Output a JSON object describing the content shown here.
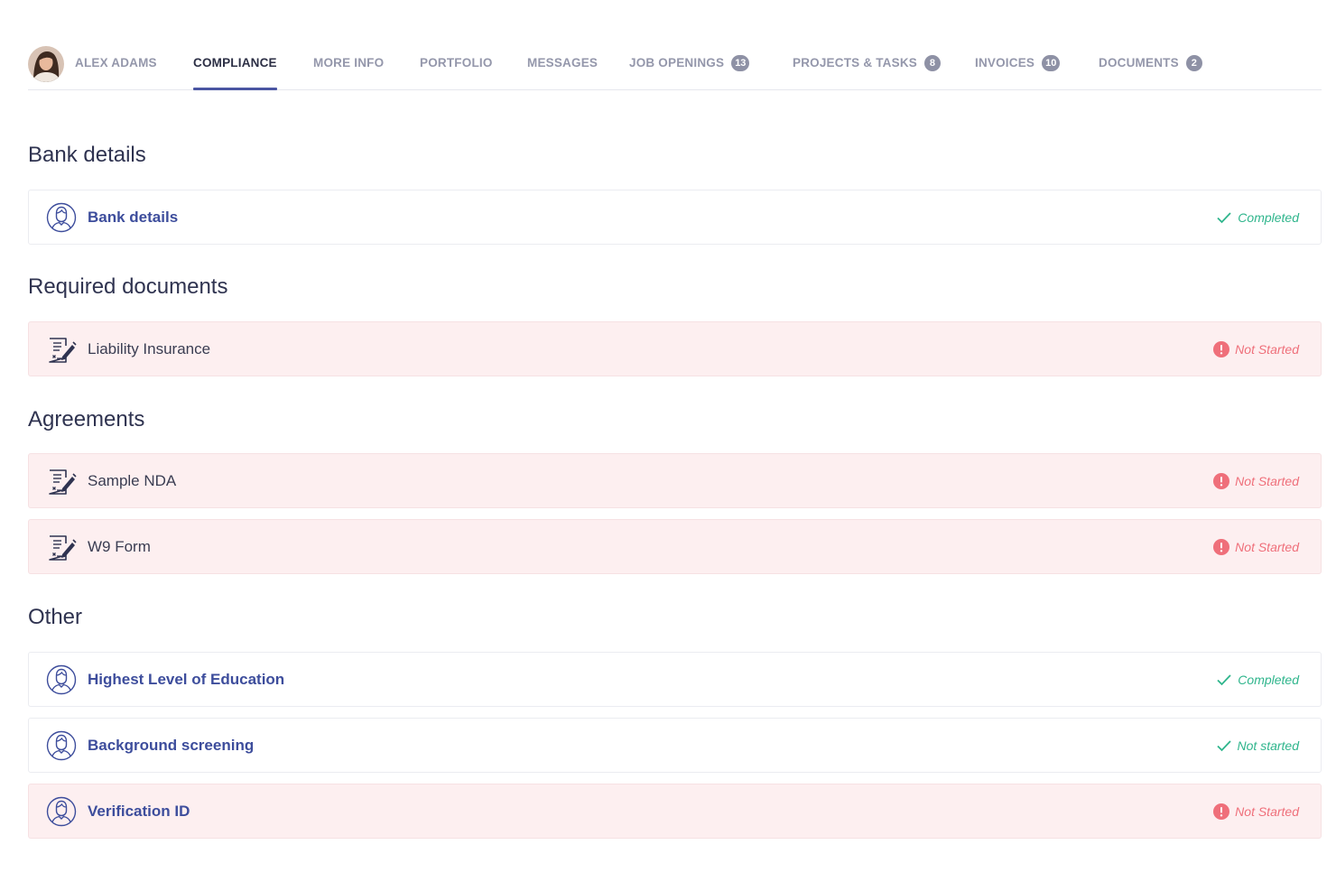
{
  "profile": {
    "name": "ALEX ADAMS"
  },
  "tabs": [
    {
      "label": "COMPLIANCE"
    },
    {
      "label": "MORE INFO"
    },
    {
      "label": "PORTFOLIO"
    },
    {
      "label": "MESSAGES"
    },
    {
      "label": "JOB OPENINGS",
      "count": "13"
    },
    {
      "label": "PROJECTS & TASKS",
      "count": "8"
    },
    {
      "label": "INVOICES",
      "count": "10"
    },
    {
      "label": "DOCUMENTS",
      "count": "2"
    }
  ],
  "active_tab": "COMPLIANCE",
  "sections": [
    {
      "title": "Bank details",
      "items": [
        {
          "label": "Bank details",
          "icon": "person-id-icon",
          "status": "Completed",
          "state": "completed"
        }
      ]
    },
    {
      "title": "Required documents",
      "items": [
        {
          "label": "Liability Insurance",
          "icon": "document-sign-icon",
          "status": "Not Started",
          "state": "pending"
        }
      ]
    },
    {
      "title": "Agreements",
      "items": [
        {
          "label": "Sample NDA",
          "icon": "document-sign-icon",
          "status": "Not Started",
          "state": "pending"
        },
        {
          "label": "W9 Form",
          "icon": "document-sign-icon",
          "status": "Not Started",
          "state": "pending"
        }
      ]
    },
    {
      "title": "Other",
      "items": [
        {
          "label": "Highest Level of Education",
          "icon": "person-id-icon",
          "status": "Completed",
          "state": "completed"
        },
        {
          "label": "Background screening",
          "icon": "person-id-icon",
          "status": "Not started",
          "state": "completed"
        },
        {
          "label": "Verification ID",
          "icon": "person-id-icon",
          "status": "Not Started",
          "state": "pending"
        }
      ]
    }
  ],
  "colors": {
    "accent": "#4a55a2",
    "completed": "#2fb58c",
    "not_started": "#ef6f7a",
    "pending_row_bg": "#fdeff0"
  }
}
